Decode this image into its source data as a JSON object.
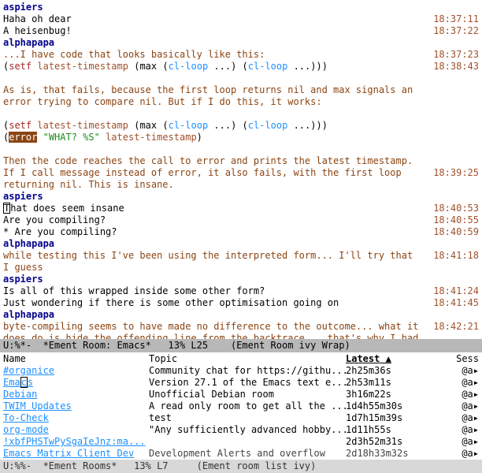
{
  "chat": {
    "lines": [
      {
        "type": "nick",
        "text": "aspiers"
      },
      {
        "type": "plain",
        "text": "Haha oh dear",
        "ts": "18:37:11"
      },
      {
        "type": "plain",
        "text": "A heisenbug!",
        "ts": "18:37:22"
      },
      {
        "type": "nick",
        "text": "alphapapa"
      },
      {
        "type": "action",
        "text": "...I have code that looks basically like this:",
        "ts": "18:37:23"
      },
      {
        "type": "code1",
        "ts": "18:38:43"
      },
      {
        "type": "blank"
      },
      {
        "type": "action",
        "text": "As is, that fails, because the first loop returns nil and max signals an error trying to compare nil. But if I do this, it works:"
      },
      {
        "type": "blank"
      },
      {
        "type": "code1"
      },
      {
        "type": "code2"
      },
      {
        "type": "blank"
      },
      {
        "type": "action",
        "text": "Then the code reaches the call to error and prints the latest timestamp."
      },
      {
        "type": "action",
        "text": "If I call message instead of error, it also fails, with the first loop returning nil. This is insane.",
        "ts": "18:39:25"
      },
      {
        "type": "nick",
        "text": "aspiers"
      },
      {
        "type": "plain-cursor",
        "prefix_cursor": "T",
        "rest": "hat does seem insane",
        "ts": "18:40:53"
      },
      {
        "type": "plain",
        "text": "Are you compiling?",
        "ts": "18:40:55"
      },
      {
        "type": "plain",
        "text": " * Are you compiling?",
        "ts": "18:40:59"
      },
      {
        "type": "nick",
        "text": "alphapapa"
      },
      {
        "type": "action",
        "text": "while testing this I've been using the interpreted form... I'll try that I guess",
        "ts": "18:41:18"
      },
      {
        "type": "nick",
        "text": "aspiers"
      },
      {
        "type": "plain",
        "text": "Is all of this wrapped inside some other form?",
        "ts": "18:41:24"
      },
      {
        "type": "plain",
        "text": "Just wondering if there is some other optimisation going on",
        "ts": "18:41:45"
      },
      {
        "type": "nick",
        "text": "alphapapa"
      },
      {
        "type": "action",
        "text": "byte-compiling seems to have made no difference to the outcome... what it does do is hide the offending line from the backtrace... that's why I had to use C-M-x on the defun",
        "ts": "18:42:21"
      }
    ],
    "code1": {
      "setf": "setf",
      "var": "latest-timestamp",
      "max": "max",
      "loop": "cl-loop",
      "dots": "..."
    },
    "code2": {
      "error": "error",
      "str": "\"WHAT? %S\"",
      "var": "latest-timestamp"
    }
  },
  "modeline_top": "U:%*-  *Ement Room: Emacs*   13% L25    (Ement Room ivy Wrap)",
  "roomlist": {
    "headers": {
      "name": "Name",
      "topic": "Topic",
      "latest": "Latest ▲",
      "sess": "Sess"
    },
    "rows": [
      {
        "name": "#organice",
        "topic": "Community chat for https://githu...",
        "latest": "2h25m36s",
        "sess": "@a▸",
        "link": true
      },
      {
        "name": "Emacs",
        "name_cursor": "c",
        "name_prefix": "Ema",
        "name_suffix": "s",
        "topic": "Version 27.1 of the Emacs text e...",
        "latest": "2h53m11s",
        "sess": "@a▸",
        "link": true,
        "cursor": true
      },
      {
        "name": "Debian",
        "topic": "Unofficial Debian room",
        "latest": "3h16m22s",
        "sess": "@a▸",
        "link": true
      },
      {
        "name": "TWIM Updates",
        "topic": "A read only room to get all the ...",
        "latest": "1d4h55m30s",
        "sess": "@a▸",
        "link": true
      },
      {
        "name": "To-Check",
        "topic": "test",
        "latest": "1d7h15m39s",
        "sess": "@a▸",
        "link": true
      },
      {
        "name": "org-mode",
        "topic": "\"Any sufficiently advanced hobby...",
        "latest": "1d11h55s",
        "sess": "@a▸",
        "link": true
      },
      {
        "name": "!xbfPHSTwPySgaIeJnz:ma...",
        "topic": "",
        "latest": "2d3h52m31s",
        "sess": "@a▸",
        "link": true
      },
      {
        "name": "Emacs Matrix Client Dev",
        "topic": "Development Alerts and overflow",
        "latest": "2d18h33m32s",
        "sess": "@a▸",
        "link": true,
        "clipped": true
      }
    ]
  },
  "modeline_bottom": "U:%%-  *Ement Rooms*   13% L7     (Ement room list ivy)"
}
